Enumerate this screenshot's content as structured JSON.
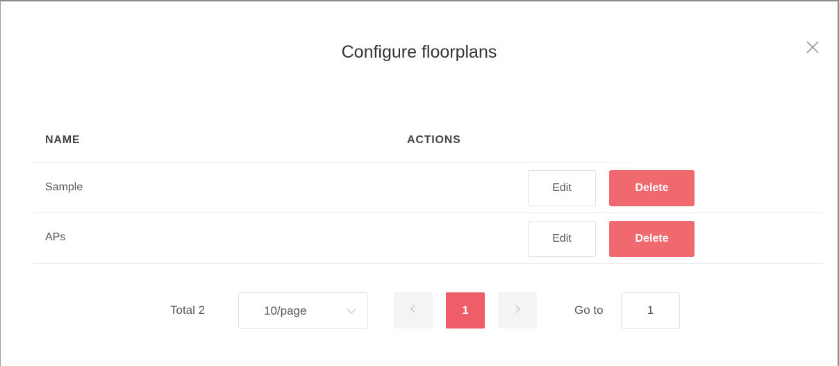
{
  "dialog": {
    "title": "Configure floorplans"
  },
  "table": {
    "columns": [
      "NAME",
      "ACTIONS"
    ],
    "rows": [
      {
        "name": "Sample",
        "edit_label": "Edit",
        "delete_label": "Delete"
      },
      {
        "name": "APs",
        "edit_label": "Edit",
        "delete_label": "Delete"
      }
    ]
  },
  "pagination": {
    "total_text": "Total 2",
    "page_size": "10/page",
    "current_page": "1",
    "goto_label": "Go to",
    "goto_value": "1"
  },
  "colors": {
    "accent": "#ef5d68",
    "delete_button": "#f0696e"
  },
  "icons": {
    "close": "close-icon",
    "dropdown": "chevron-down-icon",
    "prev": "chevron-left-icon",
    "next": "chevron-right-icon"
  }
}
